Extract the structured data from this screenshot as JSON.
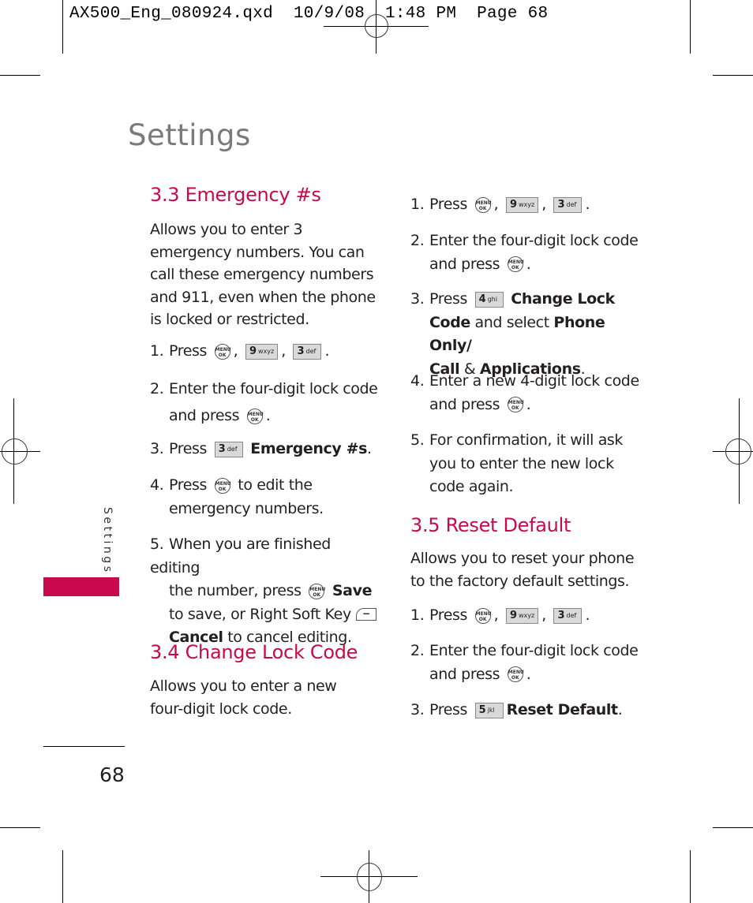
{
  "slug": "AX500_Eng_080924.qxd  10/9/08  1:48 PM  Page 68",
  "page_title": "Settings",
  "side_tab": {
    "label": "Settings",
    "accent_color": "#c8094b"
  },
  "page_number": "68",
  "accent_color": "#c8094b",
  "keys": {
    "menu_ok": {
      "top": "MENU",
      "bottom": "OK",
      "icon": "menu-ok-key-icon"
    },
    "key9": {
      "digit": "9",
      "letters": "wxyz"
    },
    "key3": {
      "digit": "3",
      "letters": "def"
    },
    "key4": {
      "digit": "4",
      "letters": "ghi"
    },
    "key5": {
      "digit": "5",
      "letters": "jkl"
    },
    "right_soft": {
      "symbol": "−",
      "icon": "right-soft-key-icon"
    }
  },
  "sections": {
    "emergency": {
      "heading": "3.3 Emergency #s",
      "intro": "Allows you to enter 3 emergency numbers. You can call these emergency numbers and 911, even when the phone is locked or restricted.",
      "steps": [
        {
          "num": "1.",
          "text_a": "Press",
          "sep1": ",",
          "sep2": ",",
          "end": "."
        },
        {
          "num": "2.",
          "text_a": "Enter the four-digit lock code",
          "text_b": "and press",
          "end": "."
        },
        {
          "num": "3.",
          "text_a": "Press",
          "bold": "Emergency #s",
          "end": "."
        },
        {
          "num": "4.",
          "text_a": "Press",
          "text_b": "to edit the",
          "text_c": "emergency numbers."
        },
        {
          "num": "5.",
          "text_a": "When you are finished editing",
          "text_b": "the number, press",
          "bold_a": "Save",
          "text_c": "to save, or Right Soft Key",
          "bold_b": "Cancel",
          "text_d": "to cancel editing."
        }
      ]
    },
    "change_lock": {
      "heading": "3.4 Change Lock Code",
      "intro": "Allows you to enter a new four-digit lock code.",
      "steps": [
        {
          "num": "1.",
          "text_a": "Press",
          "sep1": ",",
          "sep2": ",",
          "end": "."
        },
        {
          "num": "2.",
          "text_a": "Enter the four-digit lock code",
          "text_b": "and press",
          "end": "."
        },
        {
          "num": "3.",
          "text_a": "Press",
          "bold_a": "Change Lock",
          "bold_b": "Code",
          "text_b": "and select",
          "bold_c": "Phone Only/",
          "bold_d": "Call",
          "text_c": "&",
          "bold_e": "Applications",
          "end": "."
        },
        {
          "num": "4.",
          "text_a": "Enter a new 4-digit lock code",
          "text_b": "and press",
          "end": "."
        },
        {
          "num": "5.",
          "text_a": "For confirmation, it will ask",
          "text_b": "you to enter the new lock",
          "text_c": "code again."
        }
      ]
    },
    "reset": {
      "heading": "3.5 Reset Default",
      "intro": "Allows you to reset your phone to the factory default settings.",
      "steps": [
        {
          "num": "1.",
          "text_a": "Press",
          "sep1": ",",
          "sep2": ",",
          "end": "."
        },
        {
          "num": "2.",
          "text_a": "Enter the four-digit lock code",
          "text_b": "and press",
          "end": "."
        },
        {
          "num": "3.",
          "text_a": "Press",
          "bold": "Reset Default",
          "end": "."
        }
      ]
    }
  }
}
